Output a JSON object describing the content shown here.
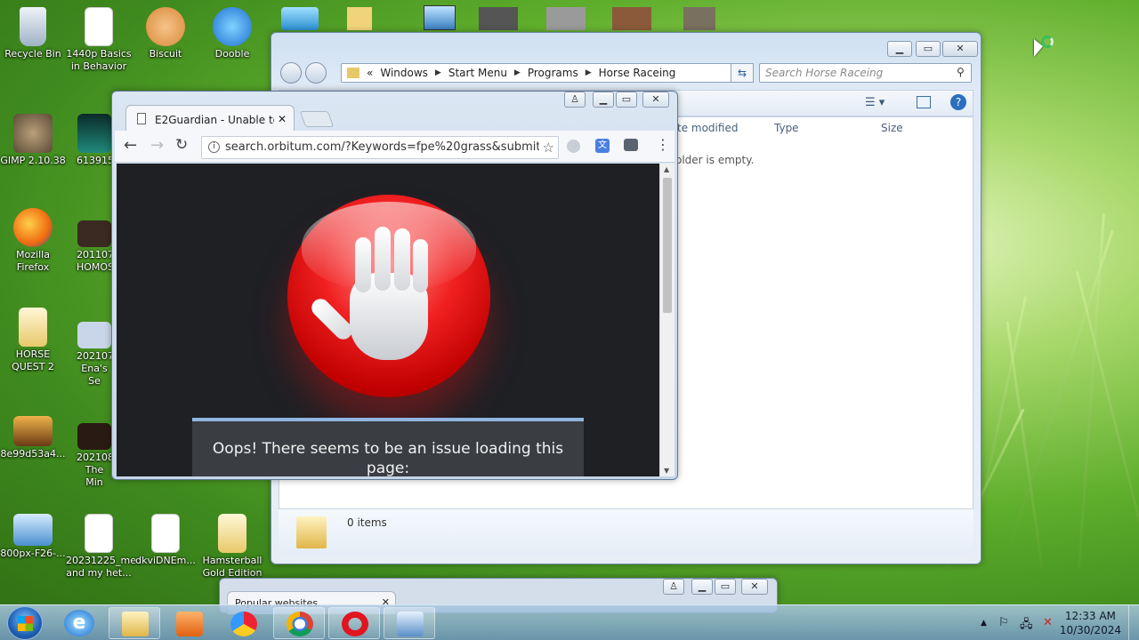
{
  "desktop": {
    "icons": [
      {
        "label": "Recycle Bin"
      },
      {
        "label": "1440p Basics in Behavior"
      },
      {
        "label": "Biscuit"
      },
      {
        "label": "Dooble"
      },
      {
        "label": "GIMP 2.10.38"
      },
      {
        "label": "613915f2"
      },
      {
        "label": "Mozilla Firefox"
      },
      {
        "label": "20110718 HOMOS"
      },
      {
        "label": "HORSE QUEST 2"
      },
      {
        "label": "2021071 Ena's Se"
      },
      {
        "label": "8e99d53a4..."
      },
      {
        "label": "2021080 The Min"
      },
      {
        "label": "800px-F26-..."
      },
      {
        "label": "20231225_me and my het..."
      },
      {
        "label": "dkviDNEm..."
      },
      {
        "label": "Hamsterball Gold Edition"
      }
    ]
  },
  "explorer": {
    "breadcrumb": [
      "Windows",
      "Start Menu",
      "Programs",
      "Horse Raceing"
    ],
    "breadcrumb_prefix": "«",
    "search_placeholder": "Search Horse Raceing",
    "columns": [
      "te modified",
      "Type",
      "Size"
    ],
    "empty_message": "older is empty.",
    "status_items": "0 items"
  },
  "browser": {
    "tab_title": "E2Guardian - Unable to",
    "url": "search.orbitum.com/?Keywords=fpe%20grass&submit=",
    "alert_text": "Oops! There seems to be an issue loading this page:"
  },
  "browser2": {
    "tab_title": "Popular websites"
  },
  "taskbar": {
    "time": "12:33 AM",
    "date": "10/30/2024"
  }
}
